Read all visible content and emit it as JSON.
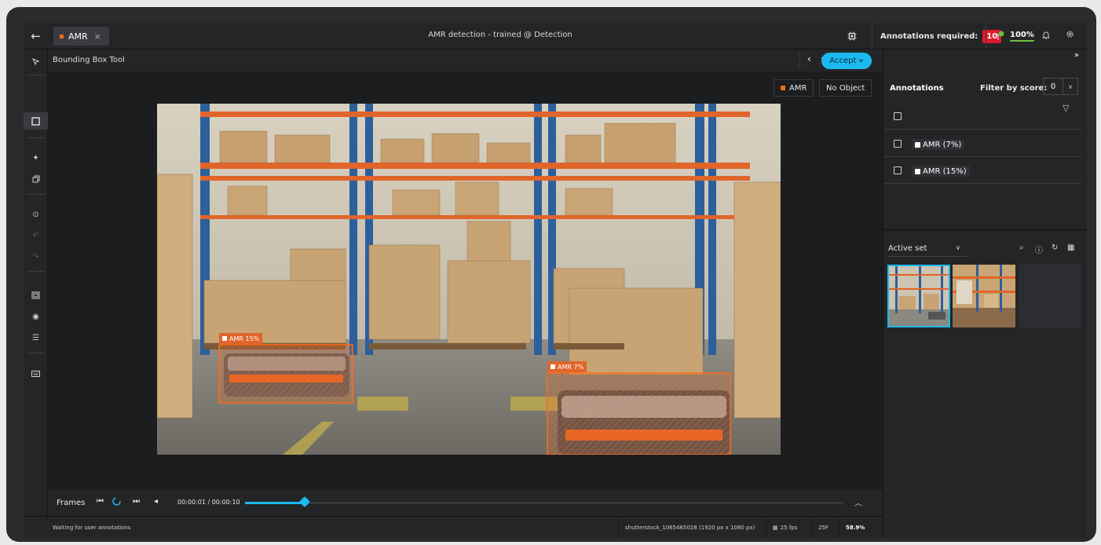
{
  "topbar": {
    "tab_label": "AMR",
    "tab_close": "×",
    "title": "AMR detection - trained @ Detection",
    "annotations_required_label": "Annotations required:",
    "annotations_required_count": "10",
    "credit_pct": "100%",
    "colors": {
      "tab_dot": "#ff6b1a",
      "badge": "#e0182d",
      "credit_underline": "#6abf40"
    }
  },
  "toolbar": {
    "tool_name": "Bounding Box Tool",
    "prev": "‹",
    "next": "›",
    "accept_label": "Accept »",
    "accept_color": "#1cb9f0"
  },
  "labels": {
    "amr": "AMR",
    "no_object": "No Object"
  },
  "detections": [
    {
      "label": "AMR 15%"
    },
    {
      "label": "AMR 7%"
    }
  ],
  "frames": {
    "label": "Frames",
    "timecode": "00:00:01 / 00:00:10",
    "progress": 0.1
  },
  "status": {
    "message": "Waiting for user annotations",
    "file": "shutterstock_1065465028 (1920 px x 1080 px)",
    "fps": "25 fps",
    "frame": "25F",
    "zoom": "58.9%"
  },
  "panel": {
    "collapse": "»",
    "annotations_title": "Annotations",
    "filter_label": "Filter by score:",
    "filter_value": "0",
    "items": [
      {
        "label": "AMR (7%)"
      },
      {
        "label": "AMR (15%)"
      }
    ],
    "active_set": "Active set"
  },
  "icons": [
    "back-arrow-icon",
    "cpu-icon",
    "credit-icon",
    "bell-icon",
    "settings-icon",
    "select-icon",
    "bounding-box-icon",
    "magic-icon",
    "copy-icon",
    "target-icon",
    "undo-icon",
    "redo-icon",
    "fit-icon",
    "eye-icon",
    "sliders-icon",
    "keyboard-icon",
    "help-icon",
    "search-icon",
    "info-icon",
    "refresh-icon",
    "grid-icon",
    "funnel-icon"
  ]
}
